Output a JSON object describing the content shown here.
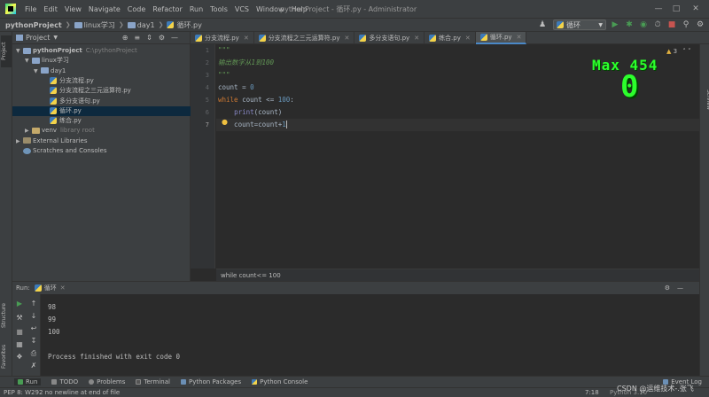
{
  "app": {
    "project_name": "pythonProject",
    "project_path": "C:\\pythonProject",
    "window_title": "pythonProject - 循环.py - Administrator",
    "menu": [
      "File",
      "Edit",
      "View",
      "Navigate",
      "Code",
      "Refactor",
      "Run",
      "Tools",
      "VCS",
      "Window",
      "Help"
    ]
  },
  "navbar": {
    "crumbs": [
      "pythonProject",
      "linux学习",
      "day1",
      "循环.py"
    ]
  },
  "toolbar": {
    "run_config": "循环"
  },
  "left_strip": {
    "project_tab": "Project",
    "structure_tab": "Structure",
    "favorites_tab": "Favorites"
  },
  "right_strip": {
    "sciview_tab": "SciView"
  },
  "project_panel": {
    "title": "Project",
    "tree": [
      {
        "label": "pythonProject",
        "extra": "C:\\pythonProject",
        "indent": 0,
        "kind": "folder",
        "expanded": true
      },
      {
        "label": "linux学习",
        "extra": "",
        "indent": 1,
        "kind": "folder",
        "expanded": true
      },
      {
        "label": "day1",
        "extra": "",
        "indent": 2,
        "kind": "folder",
        "expanded": true
      },
      {
        "label": "分支流程.py",
        "extra": "",
        "indent": 3,
        "kind": "py"
      },
      {
        "label": "分支流程之三元运算符.py",
        "extra": "",
        "indent": 3,
        "kind": "py"
      },
      {
        "label": "多分支语句.py",
        "extra": "",
        "indent": 3,
        "kind": "py"
      },
      {
        "label": "循环.py",
        "extra": "",
        "indent": 3,
        "kind": "py",
        "selected": true
      },
      {
        "label": "练合.py",
        "extra": "",
        "indent": 3,
        "kind": "py"
      },
      {
        "label": "venv",
        "extra": "library root",
        "indent": 1,
        "kind": "folder",
        "expanded": false
      },
      {
        "label": "External Libraries",
        "extra": "",
        "indent": 0,
        "kind": "lib",
        "expanded": false
      },
      {
        "label": "Scratches and Consoles",
        "extra": "",
        "indent": 0,
        "kind": "scratch"
      }
    ]
  },
  "tabs": [
    {
      "label": "分支流程.py",
      "active": false
    },
    {
      "label": "分支流程之三元运算符.py",
      "active": false
    },
    {
      "label": "多分支语句.py",
      "active": false
    },
    {
      "label": "练合.py",
      "active": false
    },
    {
      "label": "循环.py",
      "active": true
    }
  ],
  "editor": {
    "line_numbers": [
      "1",
      "2",
      "3",
      "4",
      "5",
      "6",
      "7"
    ],
    "current_line": "7",
    "lines": [
      "\"\"\"",
      "输出数字从1到100",
      "\"\"\"",
      "count = 0",
      "while count <= 100:",
      "    print(count)",
      "    count=count+1"
    ],
    "warning_count": "3",
    "breadcrumb": "while count<= 100"
  },
  "overlay": {
    "max_label": "Max 454",
    "counter": "0"
  },
  "run_panel": {
    "label": "Run:",
    "config": "循环",
    "console_lines": [
      "98",
      "99",
      "100",
      "",
      "Process finished with exit code 0"
    ]
  },
  "bottom_tools": [
    "Run",
    "TODO",
    "Problems",
    "Terminal",
    "Python Packages",
    "Python Console"
  ],
  "event_log": "Event Log",
  "status": {
    "message": "PEP 8: W292 no newline at end of file",
    "position": "7:18",
    "interpreter": "Python 3.10",
    "watermark": "CSDN @运维技术-.张飞"
  },
  "colors": {
    "accent": "#4a88c7",
    "overlay_green": "#2cff2c",
    "run_green": "#499c54"
  }
}
